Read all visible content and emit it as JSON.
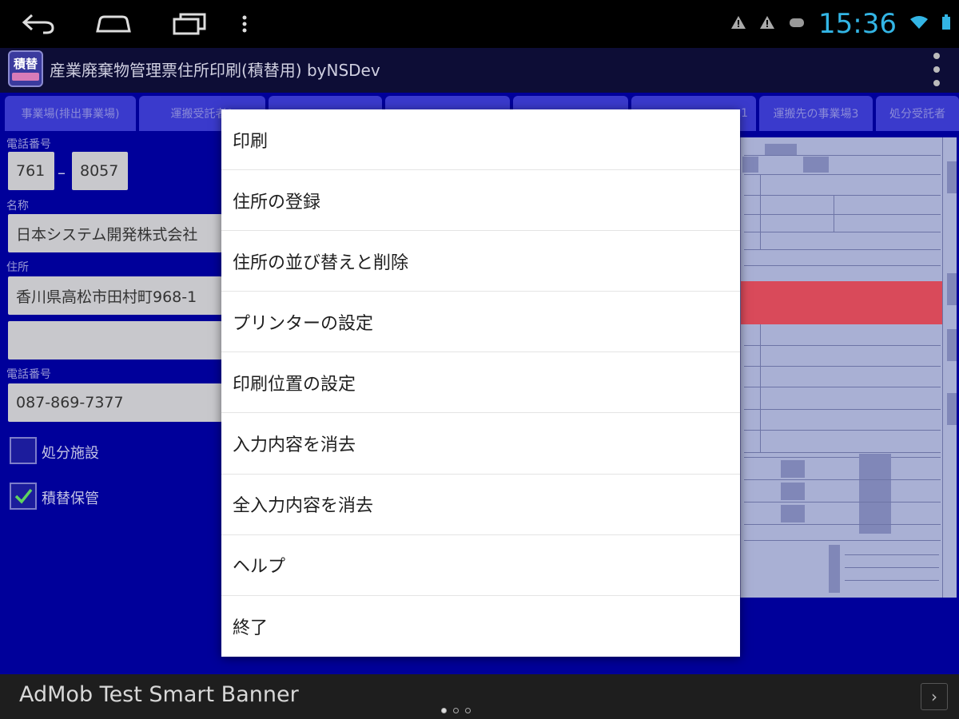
{
  "status_bar": {
    "time": "15:36",
    "icons": [
      "back-icon",
      "home-icon",
      "recent-apps-icon",
      "menu-icon",
      "warning-icon",
      "warning-icon",
      "notification-icon",
      "wifi-icon",
      "battery-icon"
    ],
    "clock_color": "#33b5e5"
  },
  "action_bar": {
    "app_icon_text": "積替",
    "title": "産業廃棄物管理票住所印刷(積替用) byNSDev"
  },
  "tabs": [
    {
      "label": "事業場(排出事業場)"
    },
    {
      "label": "運搬受託者1"
    },
    {
      "label": ""
    },
    {
      "label": ""
    },
    {
      "label": ""
    },
    {
      "label": "1"
    },
    {
      "label": "運搬先の事業場3"
    },
    {
      "label": "処分受託者"
    }
  ],
  "form": {
    "phone_label_1": "電話番号",
    "postal_1": "761",
    "postal_2": "8057",
    "name_label": "名称",
    "name_value": "日本システム開発株式会社",
    "address_label": "住所",
    "address_value": "香川県高松市田村町968-1",
    "address2_value": "",
    "phone_label_2": "電話番号",
    "phone_value": "087-869-7377",
    "checkbox_disposal": {
      "label": "処分施設",
      "checked": false
    },
    "checkbox_storage": {
      "label": "積替保管",
      "checked": true
    }
  },
  "menu": {
    "items": [
      "印刷",
      "住所の登録",
      "住所の並び替えと削除",
      "プリンターの設定",
      "印刷位置の設定",
      "入力内容を消去",
      "全入力内容を消去",
      "ヘルプ",
      "終了"
    ]
  },
  "banner": {
    "text": "AdMob Test Smart Banner"
  },
  "colors": {
    "content_bg": "#00009a",
    "tab_bg": "#3a3acc",
    "menu_bg": "#ffffff",
    "banner_bg": "#1e1e1e"
  }
}
